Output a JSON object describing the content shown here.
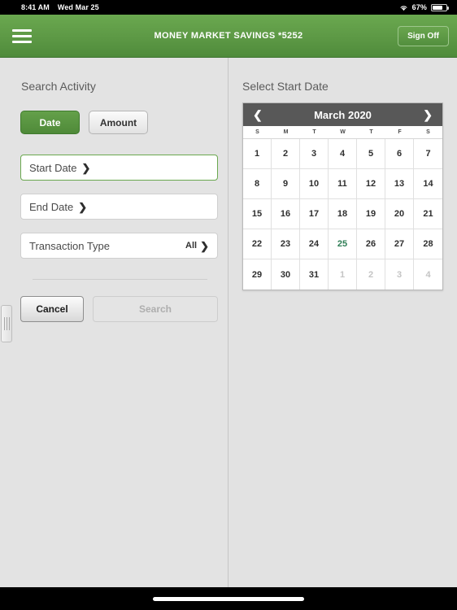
{
  "status_bar": {
    "time": "8:41 AM",
    "date": "Wed Mar 25",
    "battery_percent": "67%",
    "wifi_icon": "wifi-icon",
    "battery_icon": "battery-icon"
  },
  "app_bar": {
    "menu_icon": "hamburger-menu-icon",
    "title": "MONEY MARKET SAVINGS *5252",
    "sign_off_label": "Sign Off",
    "accent_color": "#5e9a46"
  },
  "left_panel": {
    "title": "Search Activity",
    "segmented": {
      "options": [
        {
          "label": "Date",
          "selected": true
        },
        {
          "label": "Amount",
          "selected": false
        }
      ]
    },
    "fields": [
      {
        "label": "Start Date",
        "value": "",
        "active": true,
        "chevron": "❯"
      },
      {
        "label": "End Date",
        "value": "",
        "active": false,
        "chevron": "❯"
      },
      {
        "label": "Transaction Type",
        "value": "All",
        "active": false,
        "chevron": "❯"
      }
    ],
    "buttons": {
      "cancel_label": "Cancel",
      "search_label": "Search",
      "search_disabled": true
    }
  },
  "right_panel": {
    "title": "Select Start Date",
    "calendar": {
      "month_label": "March 2020",
      "prev_icon": "chevron-left-icon",
      "next_icon": "chevron-right-icon",
      "prev_glyph": "❮",
      "next_glyph": "❯",
      "weekdays": [
        "S",
        "M",
        "T",
        "W",
        "T",
        "F",
        "S"
      ],
      "today": 25,
      "today_color": "#2e7d55",
      "weeks": [
        [
          {
            "d": "1",
            "muted": false
          },
          {
            "d": "2",
            "muted": false
          },
          {
            "d": "3",
            "muted": false
          },
          {
            "d": "4",
            "muted": false
          },
          {
            "d": "5",
            "muted": false
          },
          {
            "d": "6",
            "muted": false
          },
          {
            "d": "7",
            "muted": false
          }
        ],
        [
          {
            "d": "8",
            "muted": false
          },
          {
            "d": "9",
            "muted": false
          },
          {
            "d": "10",
            "muted": false
          },
          {
            "d": "11",
            "muted": false
          },
          {
            "d": "12",
            "muted": false
          },
          {
            "d": "13",
            "muted": false
          },
          {
            "d": "14",
            "muted": false
          }
        ],
        [
          {
            "d": "15",
            "muted": false
          },
          {
            "d": "16",
            "muted": false
          },
          {
            "d": "17",
            "muted": false
          },
          {
            "d": "18",
            "muted": false
          },
          {
            "d": "19",
            "muted": false
          },
          {
            "d": "20",
            "muted": false
          },
          {
            "d": "21",
            "muted": false
          }
        ],
        [
          {
            "d": "22",
            "muted": false
          },
          {
            "d": "23",
            "muted": false
          },
          {
            "d": "24",
            "muted": false
          },
          {
            "d": "25",
            "muted": false,
            "today": true
          },
          {
            "d": "26",
            "muted": false
          },
          {
            "d": "27",
            "muted": false
          },
          {
            "d": "28",
            "muted": false
          }
        ],
        [
          {
            "d": "29",
            "muted": false
          },
          {
            "d": "30",
            "muted": false
          },
          {
            "d": "31",
            "muted": false
          },
          {
            "d": "1",
            "muted": true
          },
          {
            "d": "2",
            "muted": true
          },
          {
            "d": "3",
            "muted": true
          },
          {
            "d": "4",
            "muted": true
          }
        ]
      ]
    }
  },
  "handle": {
    "name": "pane-resize-handle"
  }
}
